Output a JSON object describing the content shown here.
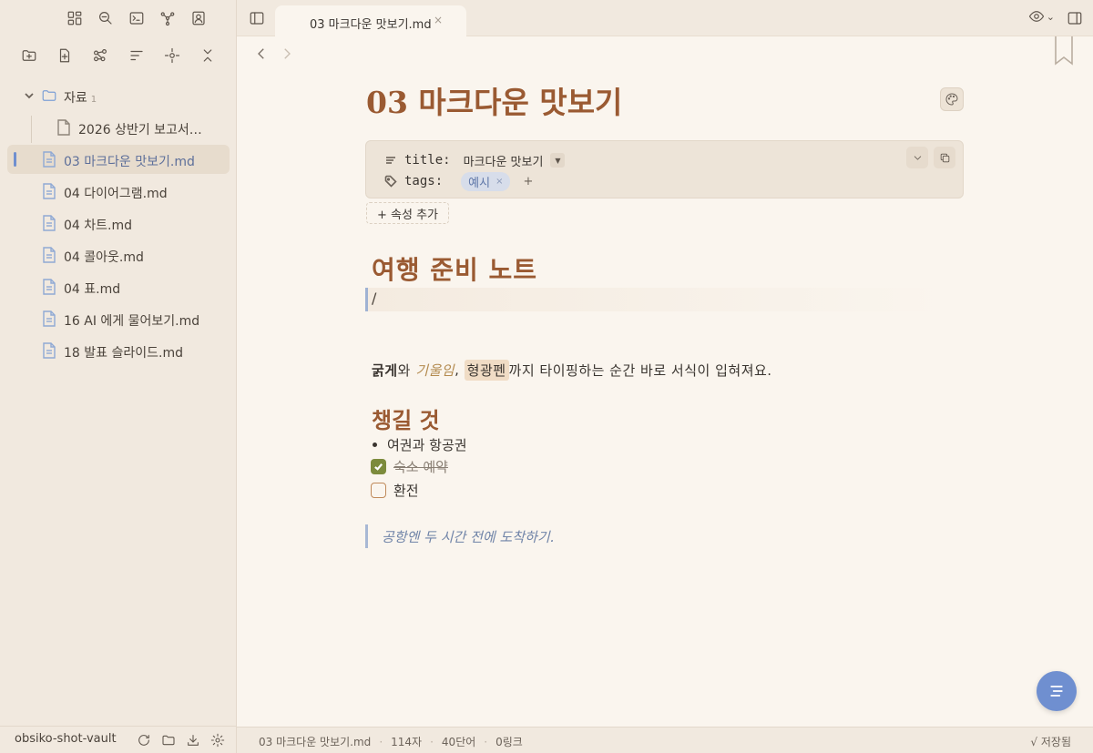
{
  "sidebar": {
    "tree": {
      "folder": {
        "name": "자료",
        "count": "1"
      },
      "folder_children": [
        "2026 상반기 보고서…"
      ],
      "files": [
        "03 마크다운 맛보기.md",
        "04 다이어그램.md",
        "04 차트.md",
        "04 콜아웃.md",
        "04 표.md",
        "16 AI 에게 물어보기.md",
        "18 발표 슬라이드.md"
      ]
    },
    "vault_name": "obsiko-shot-vault"
  },
  "tabbar": {
    "active_tab": "03 마크다운 맛보기.md",
    "close_glyph": "×",
    "view_caret": "⌄"
  },
  "editor": {
    "title": "03 마크다운 맛보기",
    "properties": {
      "title_key": "title:",
      "title_value": "마크다운 맛보기",
      "dropdown_glyph": "▼",
      "tags_key": "tags:",
      "tag": "예시",
      "tag_remove": "×",
      "tag_add": "+"
    },
    "add_property": "+ 속성 추가",
    "heading1": "여행 준비 노트",
    "cursor_text": "/",
    "paragraph": {
      "bold": "굵게",
      "t1": "와 ",
      "italic": "기울임",
      "t2": ", ",
      "highlight": "형광펜",
      "t3": "까지 타이핑하는 순간 바로 서식이 입혀져요."
    },
    "heading2": "챙길 것",
    "bullet": "여권과 항공권",
    "tasks": [
      {
        "text": "숙소 예약",
        "checked": true
      },
      {
        "text": "환전",
        "checked": false
      }
    ],
    "quote": "공항엔 두 시간 전에 도착하기."
  },
  "status": {
    "file": "03 마크다운 맛보기.md",
    "chars": "114자",
    "words": "40단어",
    "links": "0링크",
    "separator": "·",
    "saved": "√ 저장됨"
  },
  "colors": {
    "accent": "#6f8fd0",
    "heading": "#9a5a32",
    "sidebar_bg": "#f1e9df",
    "editor_bg": "#faf5ee",
    "checkbox_checked": "#7c8b3c"
  }
}
